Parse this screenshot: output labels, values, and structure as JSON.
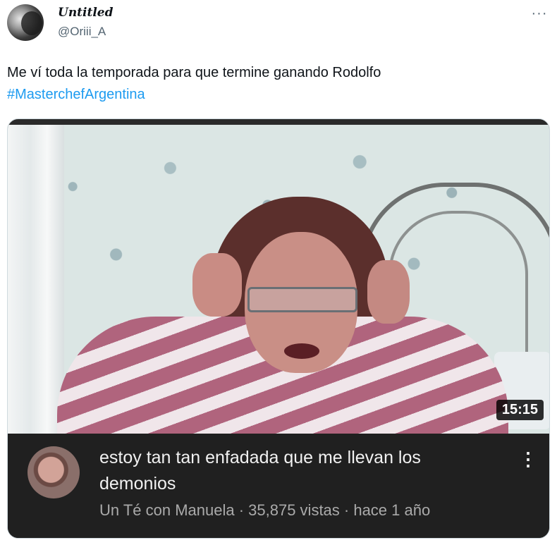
{
  "tweet": {
    "display_name": "Untitled",
    "handle": "@Oriii_A",
    "more_icon": "more-horizontal-icon",
    "text": "Me ví toda la temporada para que termine ganando Rodolfo",
    "hashtag": "#MasterchefArgentina"
  },
  "video": {
    "duration": "15:15",
    "title": "estoy tan tan enfadada que me llevan los demonios",
    "meta": "Un Té con Manuela · 35,875 vistas · hace 1 año",
    "menu_icon": "more-vertical-icon"
  },
  "colors": {
    "hashtag": "#1d9bf0",
    "handle": "#536471",
    "panel_bg": "#202020",
    "meta_text": "#aaaaaa"
  }
}
